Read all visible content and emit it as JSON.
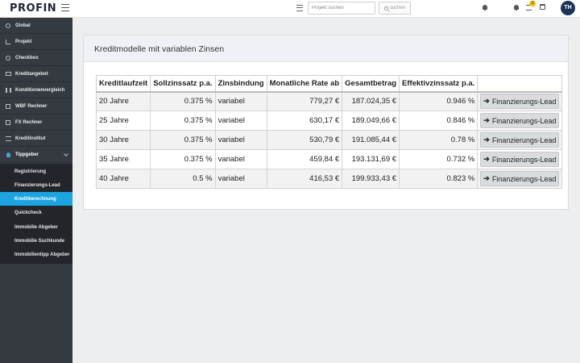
{
  "header": {
    "logo": "PROFIN",
    "search_placeholder": "Projekt suchen",
    "search_button": "suchen",
    "badge_count": "3",
    "avatar_initials": "TH"
  },
  "sidebar": {
    "items": [
      {
        "label": "Global",
        "icon": "globe-icon"
      },
      {
        "label": "Projekt",
        "icon": "sitemap-icon"
      },
      {
        "label": "Checkbox",
        "icon": "check-circle-icon"
      },
      {
        "label": "Kreditangebot",
        "icon": "card-icon"
      },
      {
        "label": "Konditionenvergleich",
        "icon": "bar-chart-icon"
      },
      {
        "label": "WBF Rechner",
        "icon": "calculator-icon"
      },
      {
        "label": "FX Rechner",
        "icon": "box-icon"
      },
      {
        "label": "Kreditinstitut",
        "icon": "bank-icon"
      },
      {
        "label": "Tippgeber",
        "icon": "lightbulb-icon"
      }
    ],
    "subitems": [
      {
        "label": "Registrierung"
      },
      {
        "label": "Finanzierungs-Lead"
      },
      {
        "label": "Kreditberechnung",
        "active": true
      },
      {
        "label": "Quickcheck"
      },
      {
        "label": "Immobilie Abgeber"
      },
      {
        "label": "Immobilie Suchkunde"
      },
      {
        "label": "Immobilientipp Abgeber"
      }
    ]
  },
  "main": {
    "title": "Kreditmodelle mit variablen Zinsen",
    "table": {
      "headers": [
        "Kreditlaufzeit",
        "Sollzinssatz p.a.",
        "Zinsbindung",
        "Monatliche Rate ab",
        "Gesamtbetrag",
        "Effektivzinssatz p.a.",
        ""
      ],
      "rows": [
        {
          "laufzeit": "20 Jahre",
          "soll": "0.375 %",
          "bindung": "variabel",
          "rate": "779,27 €",
          "gesamt": "187.024,35 €",
          "effektiv": "0.946 %",
          "button": "Finanzierungs-Lead"
        },
        {
          "laufzeit": "25 Jahre",
          "soll": "0.375 %",
          "bindung": "variabel",
          "rate": "630,17 €",
          "gesamt": "189.049,66 €",
          "effektiv": "0.846 %",
          "button": "Finanzierungs-Lead"
        },
        {
          "laufzeit": "30 Jahre",
          "soll": "0.375 %",
          "bindung": "variabel",
          "rate": "530,79 €",
          "gesamt": "191.085,44 €",
          "effektiv": "0.78 %",
          "button": "Finanzierungs-Lead"
        },
        {
          "laufzeit": "35 Jahre",
          "soll": "0.375 %",
          "bindung": "variabel",
          "rate": "459,84 €",
          "gesamt": "193.131,69 €",
          "effektiv": "0.732 %",
          "button": "Finanzierungs-Lead"
        },
        {
          "laufzeit": "40 Jahre",
          "soll": "0.5 %",
          "bindung": "variabel",
          "rate": "416,53 €",
          "gesamt": "199.933,43 €",
          "effektiv": "0.823 %",
          "button": "Finanzierungs-Lead"
        }
      ]
    }
  },
  "colors": {
    "sidebar_bg": "#353a41",
    "sidebar_sub_bg": "#22262b",
    "active_accent": "#1ba4e1",
    "avatar_bg": "#1c3557",
    "badge_bg": "#f2c200"
  }
}
